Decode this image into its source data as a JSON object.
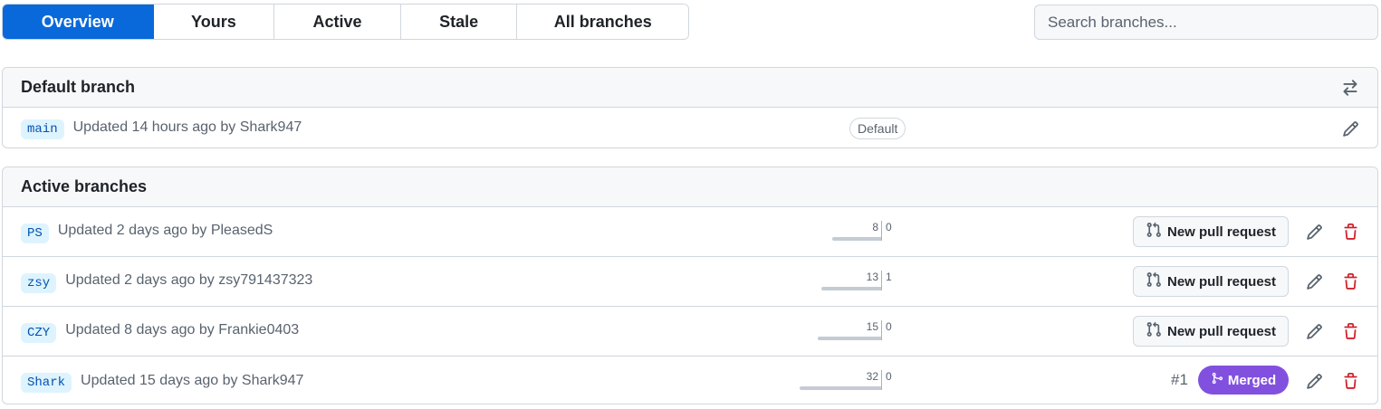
{
  "tabs": [
    "Overview",
    "Yours",
    "Active",
    "Stale",
    "All branches"
  ],
  "search": {
    "placeholder": "Search branches..."
  },
  "default_section": {
    "title": "Default branch",
    "branch": {
      "name": "main",
      "updated": "Updated 14 hours ago by Shark947",
      "badge": "Default"
    }
  },
  "active_section": {
    "title": "Active branches",
    "branches": [
      {
        "name": "PS",
        "updated": "Updated 2 days ago by PleasedS",
        "behind": "8",
        "ahead": "0",
        "action": "New pull request"
      },
      {
        "name": "zsy",
        "updated": "Updated 2 days ago by zsy791437323",
        "behind": "13",
        "ahead": "1",
        "action": "New pull request"
      },
      {
        "name": "CZY",
        "updated": "Updated 8 days ago by Frankie0403",
        "behind": "15",
        "ahead": "0",
        "action": "New pull request"
      },
      {
        "name": "Shark",
        "updated": "Updated 15 days ago by Shark947",
        "behind": "32",
        "ahead": "0",
        "pr_number": "#1",
        "status": "Merged"
      }
    ]
  },
  "icons": {
    "switch": "arrow-switch-icon",
    "edit": "pencil-icon",
    "delete": "trash-icon",
    "pull_request": "git-pull-request-icon",
    "merge": "git-merge-icon"
  },
  "colors": {
    "accent": "#0969da",
    "merged": "#8250df",
    "danger": "#cf222e",
    "branch_name_bg": "#ddf4ff",
    "branch_name_text": "#0550ae"
  }
}
